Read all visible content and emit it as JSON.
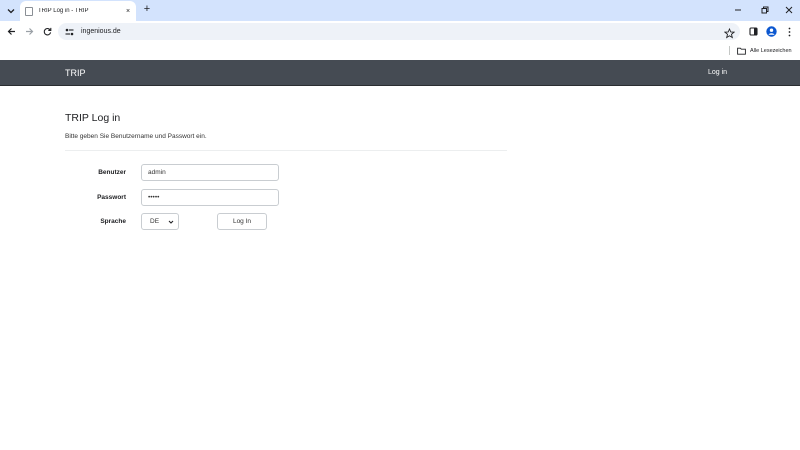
{
  "browser": {
    "tab": {
      "title": "TRIP Log in - TRIP",
      "close_glyph": "×"
    },
    "new_tab_glyph": "+",
    "url": "ingenious.de",
    "bookmarks": {
      "all_label": "Alle Lesezeichen"
    }
  },
  "page": {
    "brand": "TRIP",
    "nav_login": "Log in",
    "title": "TRIP Log in",
    "subtitle": "Bitte geben Sie Benutzername und Passwort ein.",
    "form": {
      "username_label": "Benutzer",
      "username_value": "admin",
      "password_label": "Passwort",
      "password_value": "•••••",
      "language_label": "Sprache",
      "language_value": "DE",
      "submit_label": "Log In"
    }
  },
  "colors": {
    "tabstrip": "#d3e3fd",
    "navbar": "#454b53",
    "omnibox": "#eef2f8"
  },
  "icons": [
    "tab-search-icon",
    "page-icon",
    "close-icon",
    "plus-icon",
    "minimize-icon",
    "restore-icon",
    "window-close-icon",
    "back-arrow-icon",
    "forward-arrow-icon",
    "reload-icon",
    "site-settings-icon",
    "star-icon",
    "side-panel-icon",
    "profile-icon",
    "kebab-menu-icon",
    "folder-icon",
    "chevron-down-icon"
  ]
}
